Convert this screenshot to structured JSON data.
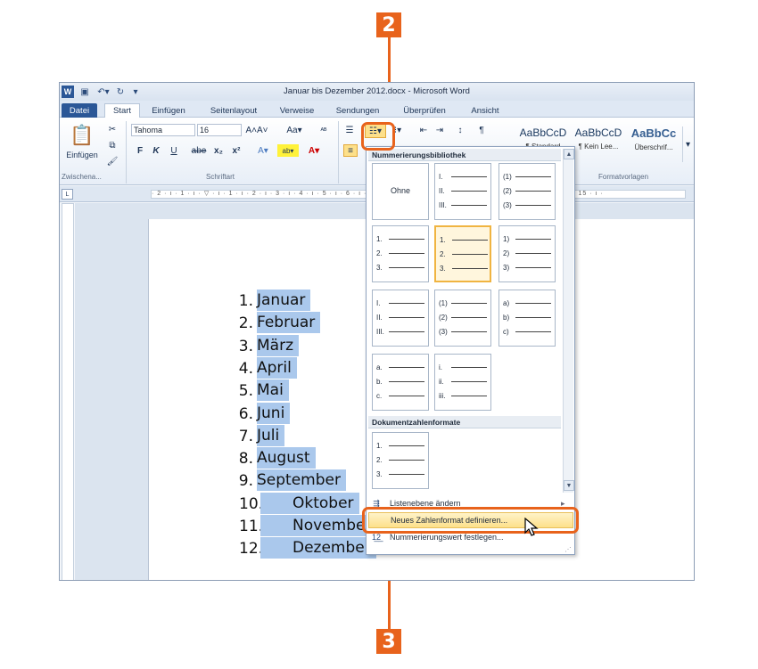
{
  "callouts": {
    "step2": "2",
    "step3": "3"
  },
  "titlebar": {
    "title": "Januar bis Dezember 2012.docx - Microsoft Word"
  },
  "tabs": [
    "Datei",
    "Start",
    "Einfügen",
    "Seitenlayout",
    "Verweise",
    "Sendungen",
    "Überprüfen",
    "Ansicht"
  ],
  "ribbon": {
    "clipboard": {
      "paste_label": "Einfügen",
      "group_label": "Zwischena..."
    },
    "font": {
      "font_name": "Tahoma",
      "font_size": "16",
      "bold": "F",
      "italic": "K",
      "underline": "U",
      "strike": "abe",
      "group_label": "Schriftart"
    },
    "styles": {
      "group_label": "Formatvorlagen",
      "items": [
        {
          "sample": "AaBbCcD",
          "name": "¶ Standard"
        },
        {
          "sample": "AaBbCcD",
          "name": "¶ Kein Lee..."
        },
        {
          "sample": "AaBbCc",
          "name": "Überschrif..."
        }
      ]
    }
  },
  "document": {
    "items": [
      {
        "num": "1.",
        "text": "Januar"
      },
      {
        "num": "2.",
        "text": "Februar"
      },
      {
        "num": "3.",
        "text": "März"
      },
      {
        "num": "4.",
        "text": "April"
      },
      {
        "num": "5.",
        "text": "Mai"
      },
      {
        "num": "6.",
        "text": "Juni"
      },
      {
        "num": "7.",
        "text": "Juli"
      },
      {
        "num": "8.",
        "text": "August"
      },
      {
        "num": "9.",
        "text": "September"
      },
      {
        "num": "10.",
        "text": "Oktober"
      },
      {
        "num": "11.",
        "text": "November"
      },
      {
        "num": "12.",
        "text": "Dezember"
      }
    ]
  },
  "numbering_menu": {
    "library_header": "Nummerierungsbibliothek",
    "none_label": "Ohne",
    "doc_formats_header": "Dokumentzahlenformate",
    "change_level": "Listenebene ändern",
    "define_new": "Neues Zahlenformat definieren...",
    "set_value": "Nummerierungswert festlegen...",
    "tiles": [
      [
        "I.",
        "II.",
        "III."
      ],
      [
        "(1)",
        "(2)",
        "(3)"
      ],
      [
        "1.",
        "2.",
        "3."
      ],
      [
        "1.",
        "2.",
        "3."
      ],
      [
        "1)",
        "2)",
        "3)"
      ],
      [
        "I.",
        "II.",
        "III."
      ],
      [
        "(1)",
        "(2)",
        "(3)"
      ],
      [
        "a)",
        "b)",
        "c)"
      ],
      [
        "a.",
        "b.",
        "c."
      ],
      [
        "i.",
        "ii.",
        "iii."
      ]
    ],
    "doc_tile": [
      "1.",
      "2.",
      "3."
    ]
  }
}
